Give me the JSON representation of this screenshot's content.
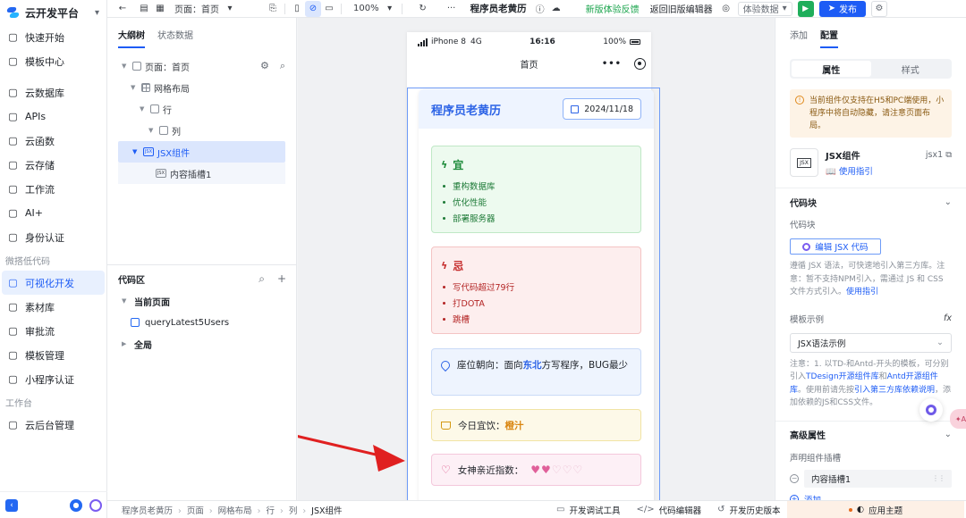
{
  "app": {
    "brand": "云开发平台"
  },
  "leftnav": {
    "items_top": [
      {
        "label": "快速开始",
        "icon": "flag-icon"
      },
      {
        "label": "模板中心",
        "icon": "template-icon"
      }
    ],
    "items_mid": [
      {
        "label": "云数据库",
        "icon": "database-icon"
      },
      {
        "label": "APIs",
        "icon": "api-icon"
      },
      {
        "label": "云函数",
        "icon": "function-icon"
      },
      {
        "label": "云存储",
        "icon": "storage-icon"
      },
      {
        "label": "工作流",
        "icon": "workflow-icon"
      },
      {
        "label": "AI+",
        "icon": "ai-icon"
      },
      {
        "label": "身份认证",
        "icon": "id-card-icon"
      }
    ],
    "group_lowcode": "微搭低代码",
    "items_lowcode": [
      {
        "label": "可视化开发",
        "icon": "visual-dev-icon",
        "active": true
      },
      {
        "label": "素材库",
        "icon": "assets-icon"
      },
      {
        "label": "审批流",
        "icon": "approval-icon"
      },
      {
        "label": "模板管理",
        "icon": "template-manage-icon"
      },
      {
        "label": "小程序认证",
        "icon": "miniprogram-icon"
      }
    ],
    "group_workbench": "工作台",
    "items_workbench": [
      {
        "label": "云后台管理",
        "icon": "admin-icon"
      }
    ]
  },
  "toolbar": {
    "page_label": "页面：首页",
    "zoom": "100%",
    "title": "程序员老黄历",
    "feedback": "新版体验反馈",
    "back_old": "返回旧版编辑器",
    "data_select": "体验数据",
    "publish": "发布"
  },
  "outline": {
    "tab_tree": "大纲树",
    "tab_state": "状态数据",
    "tree": [
      {
        "label": "页面：首页",
        "level": 0
      },
      {
        "label": "网格布局",
        "level": 1
      },
      {
        "label": "行",
        "level": 2
      },
      {
        "label": "列",
        "level": 3
      },
      {
        "label": "JSX组件",
        "level": 4
      },
      {
        "label": "内容插槽1",
        "level": 5
      }
    ],
    "code_title": "代码区",
    "current_page": "当前页面",
    "query_item": "queryLatest5Users",
    "global": "全局"
  },
  "phone": {
    "carrier": "iPhone 8",
    "network": "4G",
    "time": "16:16",
    "battery": "100%",
    "nav_title": "首页"
  },
  "card": {
    "title": "程序员老黄历",
    "date": "2024/11/18",
    "yi_title": "宜",
    "yi_items": [
      "重构数据库",
      "优化性能",
      "部署服务器"
    ],
    "ji_title": "忌",
    "ji_items": [
      "写代码超过79行",
      "打DOTA",
      "跳槽"
    ],
    "seat_prefix": "座位朝向：面向",
    "seat_highlight": "东北",
    "seat_suffix": "方写程序，BUG最少",
    "drink_prefix": "今日宜饮：",
    "drink_value": "橙汁",
    "index_label": "女神亲近指数：",
    "index_rating": 2,
    "index_max": 5,
    "colors": {
      "accent": "#2c63e6",
      "yi": "#1d8b3a",
      "ji": "#c62e2e",
      "drink": "#d9850f",
      "heart": "#e0609a"
    }
  },
  "rightpanel": {
    "tab_add": "添加",
    "tab_config": "配置",
    "seg_props": "属性",
    "seg_style": "样式",
    "notice": "当前组件仅支持在H5和PC端使用，小程序中将自动隐藏，请注意页面布局。",
    "comp_name": "JSX组件",
    "comp_guide": "使用指引",
    "comp_id": "jsx1",
    "section_code": "代码块",
    "code_label": "代码块",
    "edit_code": "编辑 JSX 代码",
    "hint1_text": "遵循 JSX 语法，可快速地引入第三方库。注意：暂不支持NPM引入，需通过 JS 和 CSS 文件方式引入。",
    "hint1_link": "使用指引",
    "tpl_label": "模板示例",
    "tpl_value": "JSX语法示例",
    "hint2_a": "注意：1. 以TD-和Antd-开头的模板，可分别引入",
    "hint2_link1": "TDesign开源组件库",
    "hint2_b": "和",
    "hint2_link2": "Antd开源组件库",
    "hint2_c": "。使用前请先按",
    "hint2_link3": "引入第三方库依赖说明",
    "hint2_d": "，添加依赖的JS和CSS文件。",
    "section_advanced": "高级属性",
    "slot_label": "声明组件插槽",
    "slot_value": "内容插槽1",
    "add_label": "添加"
  },
  "bottombar": {
    "breadcrumb": [
      "程序员老黄历",
      "页面",
      "网格布局",
      "行",
      "列",
      "JSX组件"
    ],
    "debug": "开发调试工具",
    "code_editor": "代码编辑器",
    "history": "开发历史版本",
    "theme": "应用主题"
  }
}
